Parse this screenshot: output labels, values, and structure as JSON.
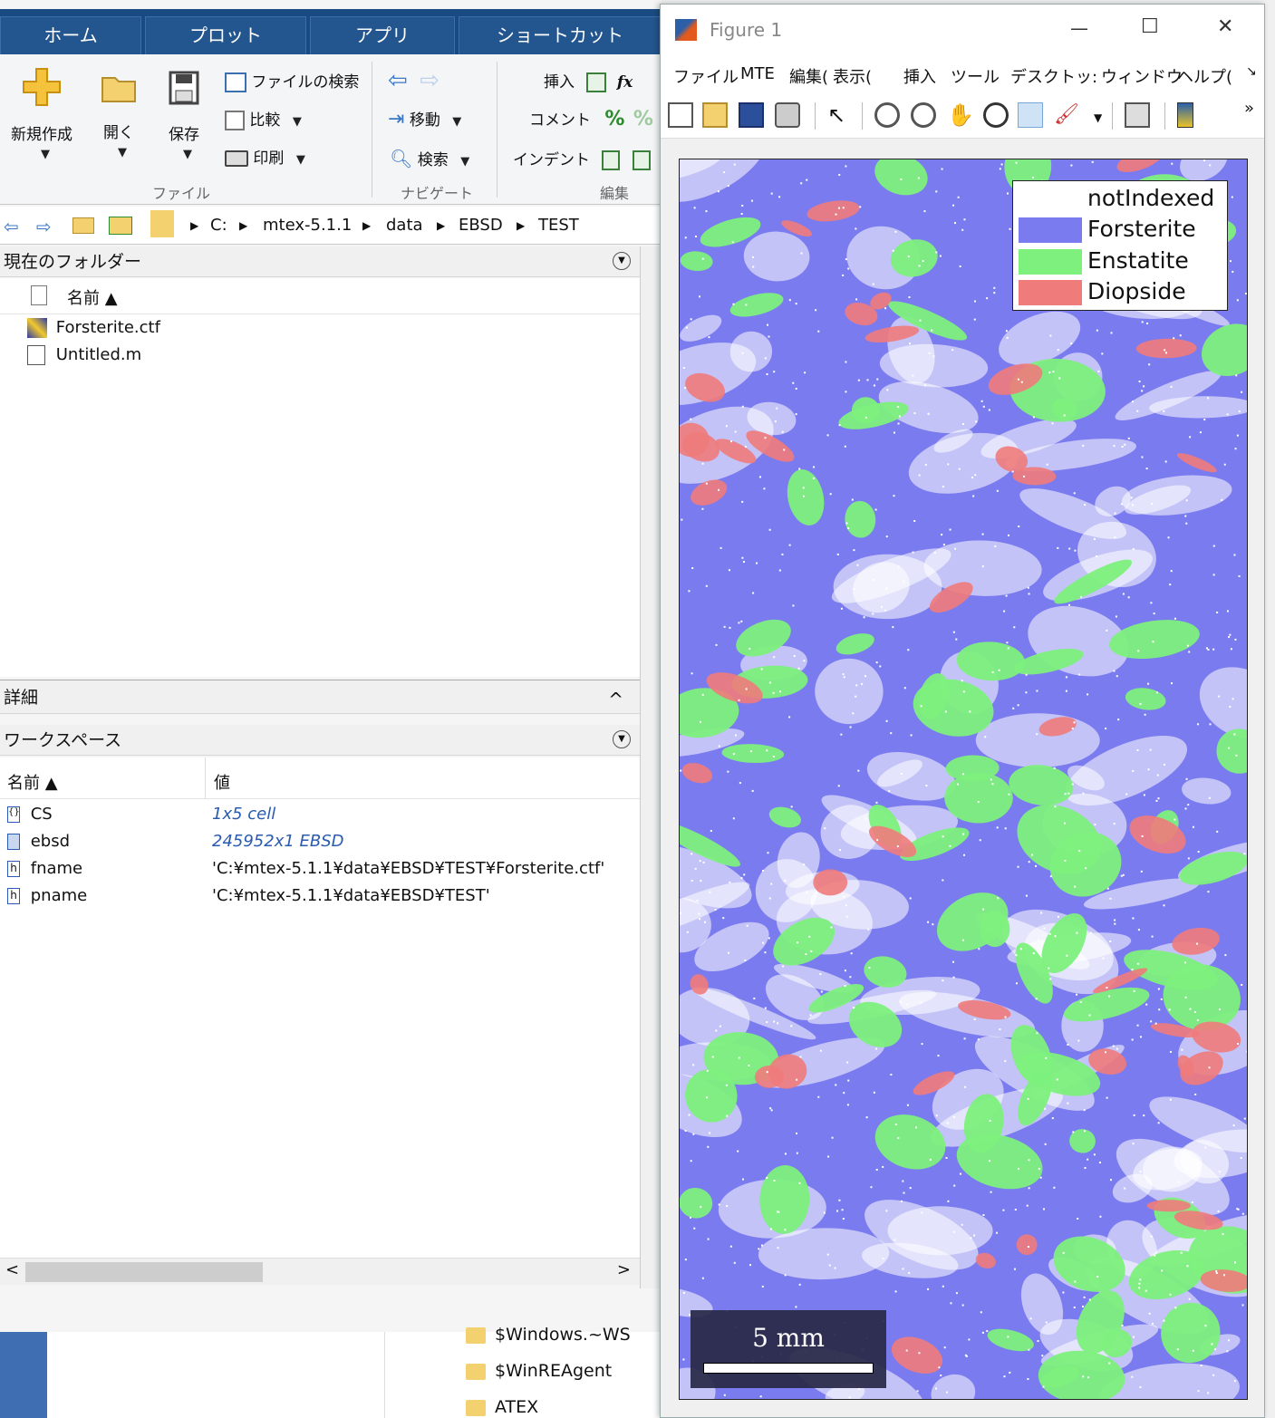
{
  "tabs": [
    "ホーム",
    "プロット",
    "アプリ",
    "ショートカット"
  ],
  "ribbon": {
    "new": "新規作成",
    "open": "開く",
    "save": "保存",
    "find_files": "ファイルの検索",
    "compare": "比較",
    "print": "印刷",
    "goto": "移動",
    "search": "検索",
    "insert": "挿入",
    "comment": "コメント",
    "indent": "インデント",
    "fx": "fx",
    "pct": "%",
    "group_file": "ファイル",
    "group_navigate": "ナビゲート",
    "group_edit": "編集"
  },
  "address": {
    "parts": [
      "C:",
      "mtex-5.1.1",
      "data",
      "EBSD",
      "TEST"
    ]
  },
  "current_folder": {
    "title": "現在のフォルダー",
    "column_name": "名前 ▲",
    "files": [
      "Forsterite.ctf",
      "Untitled.m"
    ]
  },
  "details": {
    "title": "詳細",
    "caret": "^"
  },
  "workspace": {
    "title": "ワークスペース",
    "col_name": "名前 ▲",
    "col_value": "値",
    "rows": [
      {
        "name": "CS",
        "value": "1x5 cell"
      },
      {
        "name": "ebsd",
        "value": "245952x1 EBSD"
      },
      {
        "name": "fname",
        "value": "'C:¥mtex-5.1.1¥data¥EBSD¥TEST¥Forsterite.ctf'"
      },
      {
        "name": "pname",
        "value": "'C:¥mtex-5.1.1¥data¥EBSD¥TEST'"
      }
    ]
  },
  "explorer": {
    "items": [
      "$Windows.~WS",
      "$WinREAgent",
      "ATEX"
    ]
  },
  "figure": {
    "title": "Figure 1",
    "menu": [
      "ファイル",
      "MTE",
      "編集(",
      "表示(",
      "挿入",
      "ツール",
      "デスクトッ:",
      "ウィンドウ",
      "ヘルプ(",
      "↘"
    ],
    "overflow": "»",
    "minimize": "—",
    "maximize": "☐",
    "close": "✕",
    "legend": [
      {
        "label": "notIndexed",
        "color": "#ffffff"
      },
      {
        "label": "Forsterite",
        "color": "#7b7bf0"
      },
      {
        "label": "Enstatite",
        "color": "#7df07d"
      },
      {
        "label": "Diopside",
        "color": "#f07b7b"
      }
    ],
    "scale_label": "5 mm"
  }
}
